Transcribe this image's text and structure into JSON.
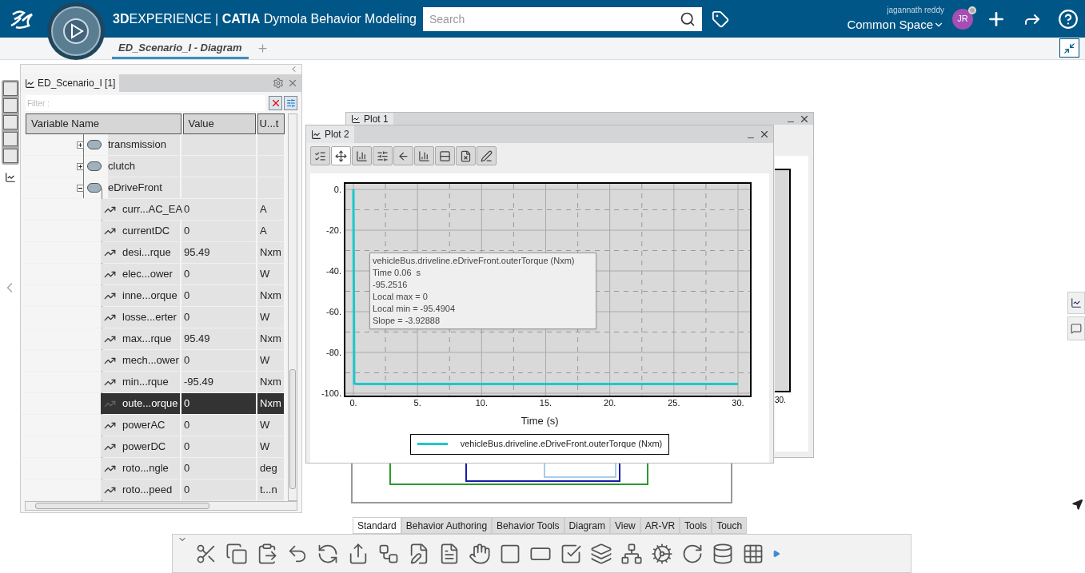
{
  "header": {
    "brand": "**3D**EXPERIENCE | **CATIA** Dymola Behavior Modeling",
    "search": {
      "placeholder": "Search"
    },
    "user_name": "jagannath reddy",
    "space": "Common Space",
    "avatar": "JR"
  },
  "doc_tabs": [
    {
      "label": "ED_Scenario_I - Diagram",
      "selected": true
    }
  ],
  "side_tabs": [
    {
      "selected": false
    },
    {
      "selected": false
    },
    {
      "selected": false
    },
    {
      "selected": false
    },
    {
      "selected": false
    },
    {
      "selected": true
    }
  ],
  "variables_panel": {
    "tab": "ED_Scenario_I [1]",
    "filter": {
      "placeholder": "Filter :"
    },
    "columns": [
      "Variable Name",
      "Value",
      "U...t"
    ],
    "rows": [
      {
        "kind": "component",
        "name": "transmission",
        "expanded": false,
        "selected": false
      },
      {
        "kind": "component",
        "name": "clutch",
        "expanded": false,
        "selected": false
      },
      {
        "kind": "component",
        "name": "eDriveFront",
        "expanded": true,
        "selected": false,
        "children": [
          {
            "kind": "variable",
            "name": "curr...AC_EA",
            "value": "0",
            "unit": "A",
            "selected": false
          },
          {
            "kind": "variable",
            "name": "currentDC",
            "value": "0",
            "unit": "A",
            "selected": false
          },
          {
            "kind": "variable",
            "name": "desi...rque",
            "value": "95.49",
            "unit": "Nxm",
            "selected": false
          },
          {
            "kind": "variable",
            "name": "elec...ower",
            "value": "0",
            "unit": "W",
            "selected": false
          },
          {
            "kind": "variable",
            "name": "inne...orque",
            "value": "0",
            "unit": "Nxm",
            "selected": false
          },
          {
            "kind": "variable",
            "name": "losse...erter",
            "value": "0",
            "unit": "W",
            "selected": false
          },
          {
            "kind": "variable",
            "name": "max...rque",
            "value": "95.49",
            "unit": "Nxm",
            "selected": false
          },
          {
            "kind": "variable",
            "name": "mech...ower",
            "value": "0",
            "unit": "W",
            "selected": false
          },
          {
            "kind": "variable",
            "name": "min...rque",
            "value": "-95.49",
            "unit": "Nxm",
            "selected": false
          },
          {
            "kind": "variable",
            "name": "oute...orque",
            "value": "0",
            "unit": "Nxm",
            "selected": true
          },
          {
            "kind": "variable",
            "name": "powerAC",
            "value": "0",
            "unit": "W",
            "selected": false
          },
          {
            "kind": "variable",
            "name": "powerDC",
            "value": "0",
            "unit": "W",
            "selected": false
          },
          {
            "kind": "variable",
            "name": "roto...ngle",
            "value": "0",
            "unit": "deg",
            "selected": false
          },
          {
            "kind": "variable",
            "name": "roto...peed",
            "value": "0",
            "unit": "t...n",
            "selected": false
          }
        ]
      }
    ]
  },
  "plot1": {
    "title": "Plot 1",
    "tick": "30."
  },
  "plot2": {
    "title": "Plot 2",
    "tools": [
      {
        "selected": false
      },
      {
        "selected": true
      },
      {
        "selected": false
      },
      {
        "selected": false
      },
      {
        "selected": false
      },
      {
        "selected": false
      },
      {
        "selected": false
      },
      {
        "selected": false
      },
      {
        "selected": false
      }
    ],
    "chart_data": {
      "type": "line",
      "xlabel": "Time (s)",
      "x": [
        0,
        0.06,
        0.3,
        30
      ],
      "series": [
        {
          "name": "vehicleBus.driveline.eDriveFront.outerTorque (Nxm)",
          "color": "#1cc7cc",
          "values": [
            0,
            -95.3,
            -95.5,
            -95.5
          ]
        }
      ],
      "grid": true,
      "xlim": [
        0,
        30
      ],
      "ylim": [
        -100,
        0
      ],
      "xticks": [
        {
          "value": 0,
          "label": "0."
        },
        {
          "value": 5,
          "label": "5."
        },
        {
          "value": 10,
          "label": "10."
        },
        {
          "value": 15,
          "label": "15."
        },
        {
          "value": 20,
          "label": "20."
        },
        {
          "value": 25,
          "label": "25."
        },
        {
          "value": 30,
          "label": "30."
        }
      ],
      "yticks": [
        {
          "value": 0,
          "label": "0."
        },
        {
          "value": -20,
          "label": "-20."
        },
        {
          "value": -40,
          "label": "-40."
        },
        {
          "value": -60,
          "label": "-60."
        },
        {
          "value": -80,
          "label": "-80."
        },
        {
          "value": -100,
          "label": "-100."
        }
      ]
    },
    "tooltip": [
      "vehicleBus.driveline.eDriveFront.outerTorque (Nxm)",
      "Time 0.06  s",
      "-95.2516",
      "Local max = 0",
      "Local min = -95.4904",
      "Slope = -3.92888"
    ]
  },
  "ribbon_tabs": [
    {
      "label": "Standard",
      "selected": true
    },
    {
      "label": "Behavior Authoring",
      "selected": false
    },
    {
      "label": "Behavior Tools",
      "selected": false
    },
    {
      "label": "Diagram",
      "selected": false
    },
    {
      "label": "View",
      "selected": false
    },
    {
      "label": "AR-VR",
      "selected": false
    },
    {
      "label": "Tools",
      "selected": false
    },
    {
      "label": "Touch",
      "selected": false
    }
  ]
}
